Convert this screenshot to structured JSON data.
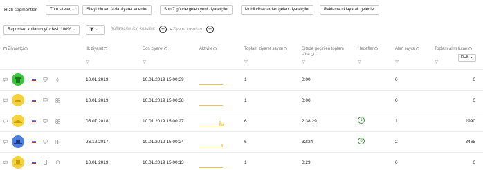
{
  "top_bar": {
    "quick_segments_label": "Hızlı segmentler",
    "all_sites": "Tüm siteler",
    "segments": [
      "Siteyi birden fazla ziyaret edenler",
      "Son 7 günde gelen yeni ziyaretçiler",
      "Mobil cihazlardan gelen ziyaretçiler",
      "Reklama tıklayarak gelenler"
    ]
  },
  "filter_bar": {
    "percent_label": "Rapordaki kullanıcı yüzdesi: 100%",
    "user_conditions": "Kullanıcılar için koşullar:",
    "visit_conditions": "Ziyaret koşulları"
  },
  "columns": {
    "visitor": "Ziyaretçi",
    "first_visit": "İlk ziyaret",
    "last_visit": "Son ziyaret",
    "activity": "Aktivite",
    "total_visits": "Toplam ziyaret sayısı",
    "time_on_site": "Sitede geçirilen toplam süre",
    "goals": "Hedefler",
    "purchases": "Alım sayısı",
    "total_revenue": "Toplam alım tutarı",
    "currency": "RUB"
  },
  "rows": [
    {
      "first": "10.01.2019",
      "last": "10.01.2019 15:00:39",
      "visits": "1",
      "time": "0:00",
      "goal": "",
      "purchases": "0",
      "revenue": "0"
    },
    {
      "first": "10.01.2019",
      "last": "10.01.2019 15:00:38",
      "visits": "1",
      "time": "0:00",
      "goal": "",
      "purchases": "0",
      "revenue": "0"
    },
    {
      "first": "05.07.2018",
      "last": "10.01.2019 15:00:27",
      "visits": "6",
      "time": "2:38:29",
      "goal": "1",
      "purchases": "1",
      "revenue": "2990"
    },
    {
      "first": "26.12.2017",
      "last": "10.01.2019 15:00:24",
      "visits": "6",
      "time": "32:24",
      "goal": "8",
      "purchases": "2",
      "revenue": "3465"
    },
    {
      "first": "10.01.2019",
      "last": "10.01.2019 15:00:13",
      "visits": "1",
      "time": "0:29",
      "goal": "",
      "purchases": "0",
      "revenue": "0"
    }
  ],
  "colors": {
    "avatar_green": "#3cc43c",
    "avatar_yellow": "#f5d23c",
    "avatar_blue": "#4a7fe0",
    "sparkline": "#f0b400",
    "goal_green": "#2b7a2b"
  }
}
